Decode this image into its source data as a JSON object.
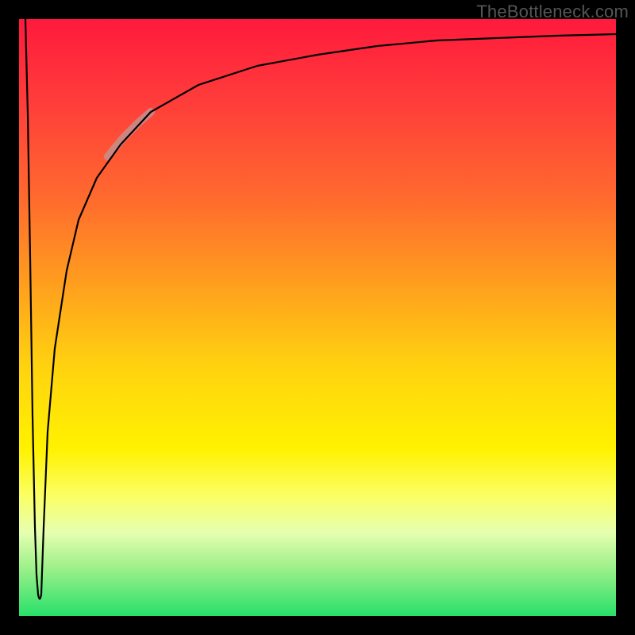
{
  "watermark": "TheBottleneck.com",
  "chart_data": {
    "type": "line",
    "title": "",
    "subtitle": "",
    "xlabel": "",
    "ylabel": "",
    "xlim": [
      0,
      1
    ],
    "ylim": [
      0,
      1
    ],
    "series": [
      {
        "name": "bottleneck-curve",
        "description": "Composite curve: starts at y≈1 at x≈0, drops sharply to a minimum near x≈0.03 (y≈0.03), then rises steeply and asymptotically approaches y≈0.97. Values sampled left→right.",
        "x": [
          0.0,
          0.01,
          0.02,
          0.03,
          0.04,
          0.06,
          0.08,
          0.1,
          0.13,
          0.17,
          0.22,
          0.3,
          0.4,
          0.5,
          0.6,
          0.7,
          0.8,
          0.9,
          1.0
        ],
        "values": [
          1.0,
          0.65,
          0.2,
          0.03,
          0.2,
          0.45,
          0.58,
          0.66,
          0.73,
          0.79,
          0.84,
          0.89,
          0.92,
          0.94,
          0.955,
          0.962,
          0.968,
          0.972,
          0.975
        ]
      },
      {
        "name": "highlighted-segment",
        "description": "Short lighter segment overlaid on the rising part of the curve, roughly between x∈[0.15, 0.22].",
        "x": [
          0.15,
          0.175,
          0.2,
          0.22
        ],
        "values": [
          0.77,
          0.8,
          0.825,
          0.845
        ]
      }
    ],
    "annotations": [],
    "legend": {
      "visible": false
    },
    "grid": false,
    "background_gradient": {
      "top": "#ff1a3c",
      "middle": "#fff200",
      "bottom": "#28e06a"
    }
  }
}
